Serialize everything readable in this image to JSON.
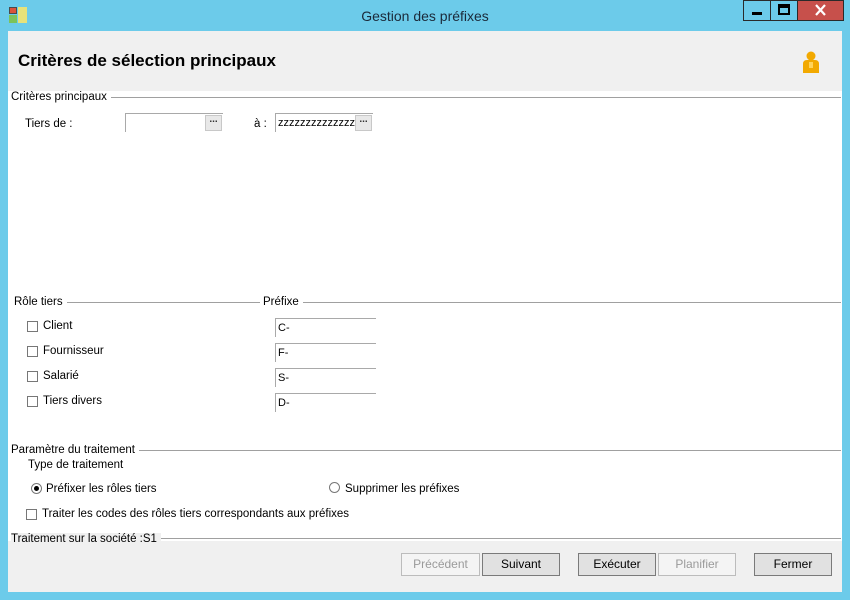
{
  "window": {
    "title": "Gestion des préfixes",
    "minimize": "▁",
    "maximize": "□",
    "close": "✕"
  },
  "header": {
    "title": "Critères de sélection principaux",
    "icon": "user-icon"
  },
  "criteria": {
    "group_title": "Critères principaux",
    "tiers_from_label": "Tiers de :",
    "tiers_from_value": "",
    "tiers_to_label": "à :",
    "tiers_to_value": "zzzzzzzzzzzzzz",
    "browse_label": "..."
  },
  "roles": {
    "group_title": "Rôle tiers",
    "prefix_title": "Préfixe",
    "items": [
      {
        "label": "Client",
        "prefix": "C-",
        "checked": false
      },
      {
        "label": "Fournisseur",
        "prefix": "F-",
        "checked": false
      },
      {
        "label": "Salarié",
        "prefix": "S-",
        "checked": false
      },
      {
        "label": "Tiers divers",
        "prefix": "D-",
        "checked": false
      }
    ]
  },
  "processing": {
    "group_title": "Paramètre du traitement",
    "type_label": "Type de traitement",
    "option_prefix": "Préfixer les rôles tiers",
    "option_remove": "Supprimer les préfixes",
    "selected": "prefix",
    "codes_label": "Traiter les codes des rôles tiers correspondants aux préfixes"
  },
  "footer": {
    "company_label": "Traitement sur la société :S1",
    "buttons": {
      "previous": "Précédent",
      "next": "Suivant",
      "execute": "Exécuter",
      "schedule": "Planifier",
      "close": "Fermer"
    }
  },
  "colors": {
    "titlebar": "#6ccbea",
    "close_button": "#c7504b",
    "header_bg": "#f0f0f0"
  }
}
